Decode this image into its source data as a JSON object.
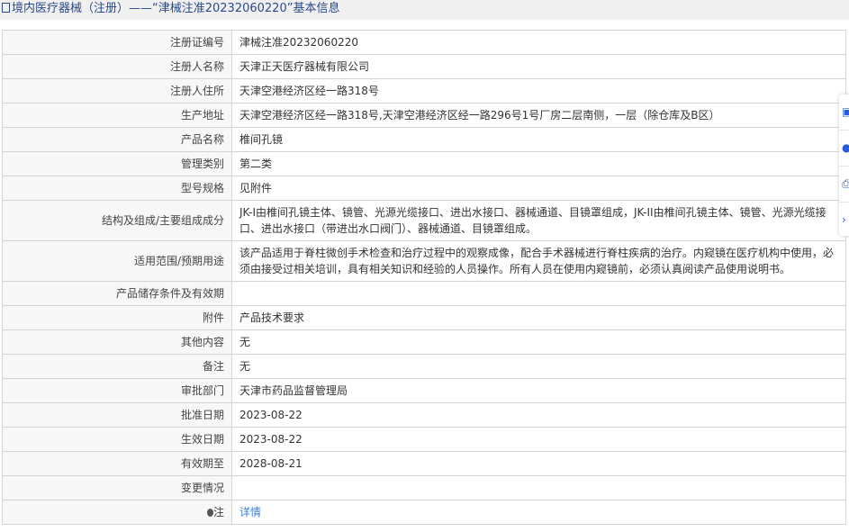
{
  "header": {
    "title": "境内医疗器械（注册）——“津械注准20232060220”基本信息",
    "icon": "document-icon"
  },
  "rows": [
    {
      "label": "注册证编号",
      "value": "津械注准20232060220"
    },
    {
      "label": "注册人名称",
      "value": "天津正天医疗器械有限公司"
    },
    {
      "label": "注册人住所",
      "value": "天津空港经济区经一路318号"
    },
    {
      "label": "生产地址",
      "value": "天津空港经济区经一路318号,天津空港经济区经一路296号1号厂房二层南侧，一层（除仓库及B区）"
    },
    {
      "label": "产品名称",
      "value": "椎间孔镜"
    },
    {
      "label": "管理类别",
      "value": "第二类"
    },
    {
      "label": "型号规格",
      "value": "见附件"
    },
    {
      "label": "结构及组成/主要组成成分",
      "value": "JK-I由椎间孔镜主体、镜管、光源光缆接口、进出水接口、器械通道、目镜罩组成，JK-II由椎间孔镜主体、镜管、光源光缆接口、进出水接口（带进出水口阀门）、器械通道、目镜罩组成。"
    },
    {
      "label": "适用范围/预期用途",
      "value": "该产品适用于脊柱微创手术检查和治疗过程中的观察成像，配合手术器械进行脊柱疾病的治疗。内窥镜在医疗机构中使用，必须由接受过相关培训，具有相关知识和经验的人员操作。所有人员在使用内窥镜前，必须认真阅读产品使用说明书。"
    },
    {
      "label": "产品储存条件及有效期",
      "value": ""
    },
    {
      "label": "附件",
      "value": "产品技术要求"
    },
    {
      "label": "其他内容",
      "value": "无"
    },
    {
      "label": "备注",
      "value": "无"
    },
    {
      "label": "审批部门",
      "value": "天津市药品监督管理局"
    },
    {
      "label": "批准日期",
      "value": "2023-08-22"
    },
    {
      "label": "生效日期",
      "value": "2023-08-22"
    },
    {
      "label": "有效期至",
      "value": "2028-08-21"
    },
    {
      "label": "变更情况",
      "value": ""
    }
  ],
  "note": {
    "label": "注",
    "link": "详情"
  }
}
